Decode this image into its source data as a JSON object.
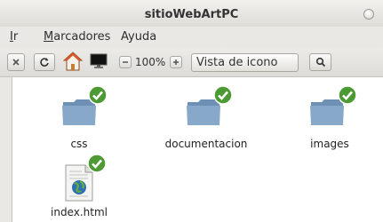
{
  "window": {
    "title": "sitioWebArtPC"
  },
  "menu": {
    "items": [
      {
        "label": "Ir",
        "mnemonic": "I",
        "rest": "r"
      },
      {
        "label": "Marcadores",
        "mnemonic": "M",
        "rest": "arcadores"
      },
      {
        "label": "Ayuda",
        "mnemonic": "Ayu",
        "rest": "da"
      }
    ]
  },
  "toolbar": {
    "stop_icon": "close-icon",
    "reload_icon": "reload-icon",
    "home_icon": "home-icon",
    "computer_icon": "computer-icon",
    "zoom_level": "100%",
    "view_mode": "Vista de icono",
    "search_icon": "search-icon"
  },
  "files": [
    {
      "name": "css",
      "type": "folder",
      "status": "synced"
    },
    {
      "name": "documentacion",
      "type": "folder",
      "status": "synced"
    },
    {
      "name": "images",
      "type": "folder",
      "status": "synced"
    },
    {
      "name": "index.html",
      "type": "html-file",
      "status": "synced"
    }
  ],
  "colors": {
    "folder": "#7b9fc2",
    "badge": "#4d9a34",
    "background": "#ffffff"
  }
}
